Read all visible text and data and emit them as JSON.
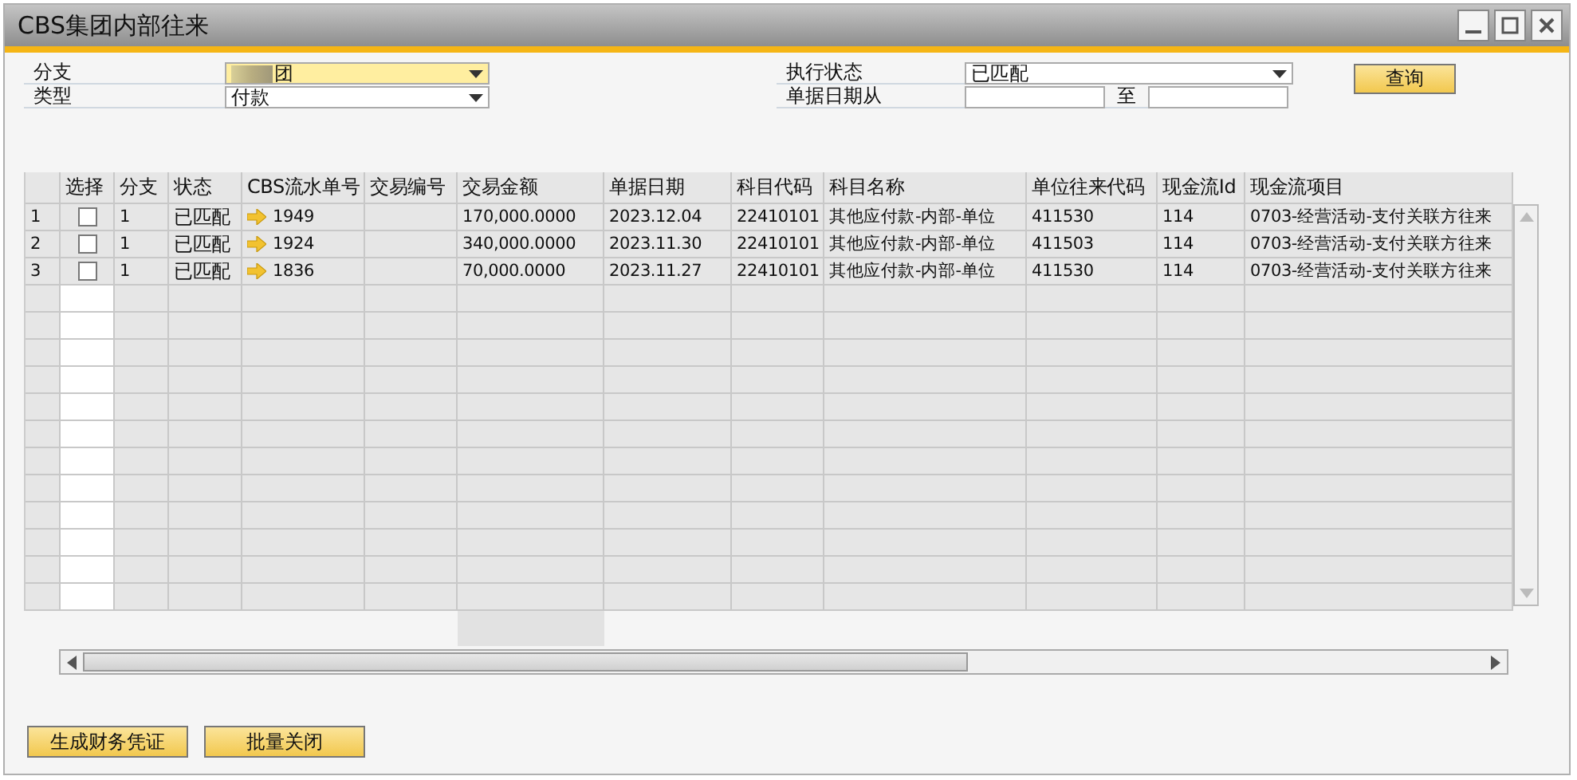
{
  "window": {
    "title": "CBS集团内部往来"
  },
  "filters": {
    "branch": {
      "label": "分支",
      "value": "团"
    },
    "type": {
      "label": "类型",
      "value": "付款"
    },
    "status": {
      "label": "执行状态",
      "value": "已匹配"
    },
    "date_from": {
      "label": "单据日期从"
    },
    "date_to": {
      "label": "至"
    },
    "query_button": "查询"
  },
  "table": {
    "columns": [
      "选择",
      "分支",
      "状态",
      "CBS流水单号",
      "交易编号",
      "交易金额",
      "单据日期",
      "科目代码",
      "科目名称",
      "单位往来代码",
      "现金流Id",
      "现金流项目"
    ],
    "rows": [
      {
        "row_number": "1",
        "checked": false,
        "branch": "1",
        "status": "已匹配",
        "cbs_no": "1949",
        "amount": "170,000.0000",
        "date": "2023.12.04",
        "account_code": "22410101",
        "account_name": "其他应付款-内部-单位",
        "partner_code": "411530",
        "cashflow_id": "114",
        "cashflow_item": "0703-经营活动-支付关联方往来"
      },
      {
        "row_number": "2",
        "checked": false,
        "branch": "1",
        "status": "已匹配",
        "cbs_no": "1924",
        "amount": "340,000.0000",
        "date": "2023.11.30",
        "account_code": "22410101",
        "account_name": "其他应付款-内部-单位",
        "partner_code": "411503",
        "cashflow_id": "114",
        "cashflow_item": "0703-经营活动-支付关联方往来"
      },
      {
        "row_number": "3",
        "checked": false,
        "branch": "1",
        "status": "已匹配",
        "cbs_no": "1836",
        "amount": "70,000.0000",
        "date": "2023.11.27",
        "account_code": "22410101",
        "account_name": "其他应付款-内部-单位",
        "partner_code": "411530",
        "cashflow_id": "114",
        "cashflow_item": "0703-经营活动-支付关联方往来"
      }
    ]
  },
  "buttons": [
    "生成财务凭证",
    "批量关闭"
  ]
}
